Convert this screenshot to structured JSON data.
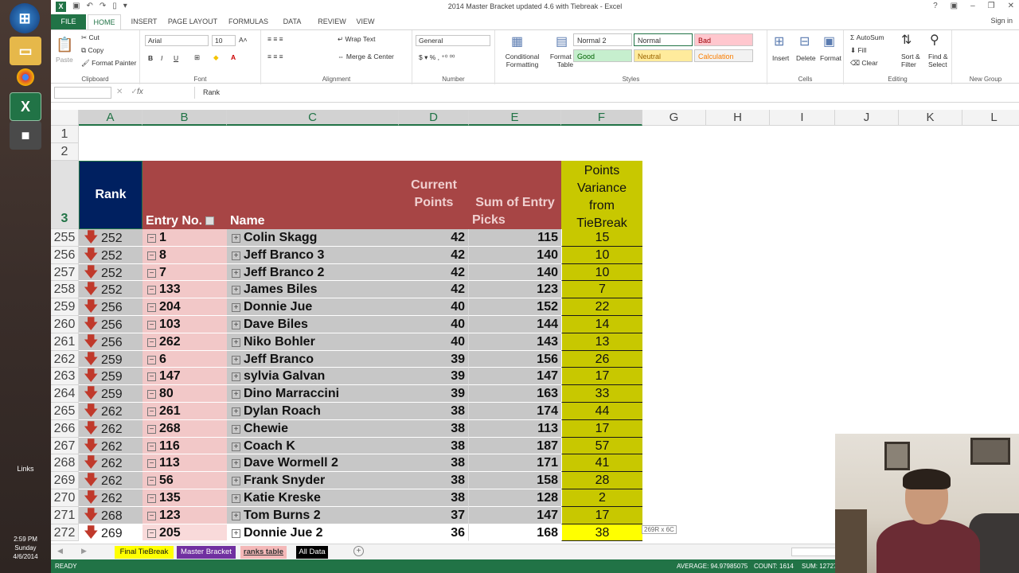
{
  "taskbar": {
    "links_label": "Links",
    "time": "2:59 PM",
    "day": "Sunday",
    "date": "4/6/2014"
  },
  "window": {
    "title": "2014 Master Bracket updated 4.6 with Tiebreak - Excel",
    "signin": "Sign in"
  },
  "ribbon_tabs": [
    "FILE",
    "HOME",
    "INSERT",
    "PAGE LAYOUT",
    "FORMULAS",
    "DATA",
    "REVIEW",
    "VIEW"
  ],
  "ribbon": {
    "clipboard": {
      "cut": "Cut",
      "copy": "Copy",
      "format_painter": "Format Painter",
      "paste": "Paste",
      "label": "Clipboard"
    },
    "font": {
      "name": "Arial",
      "size": "10",
      "label": "Font"
    },
    "alignment": {
      "wrap": "Wrap Text",
      "merge": "Merge & Center",
      "label": "Alignment"
    },
    "number": {
      "format": "General",
      "label": "Number"
    },
    "styles": {
      "conditional": "Conditional Formatting",
      "format_table": "Format as Table",
      "normal2": "Normal 2",
      "normal": "Normal",
      "bad": "Bad",
      "good": "Good",
      "neutral": "Neutral",
      "calculation": "Calculation",
      "label": "Styles"
    },
    "cells": {
      "insert": "Insert",
      "delete": "Delete",
      "format": "Format",
      "label": "Cells"
    },
    "editing": {
      "autosum": "AutoSum",
      "fill": "Fill",
      "clear": "Clear",
      "sort": "Sort & Filter",
      "find": "Find & Select",
      "label": "Editing"
    },
    "new_group": "New Group"
  },
  "formula_bar": {
    "fx": "fx",
    "value": "Rank"
  },
  "columns": [
    "A",
    "B",
    "C",
    "D",
    "E",
    "F",
    "G",
    "H",
    "I",
    "J",
    "K",
    "L"
  ],
  "header_rows": [
    "1",
    "2",
    "3"
  ],
  "table_header": {
    "rank": "Rank",
    "entry_no": "Entry No.",
    "name": "Name",
    "current_points": [
      "Current",
      "Points"
    ],
    "sum_picks": [
      "Sum of Entry",
      "Picks"
    ],
    "variance": [
      "Points",
      "Variance",
      "from",
      "TieBreak"
    ]
  },
  "rows": [
    {
      "row": "255",
      "rank": "252",
      "entry": "1",
      "name": "Colin Skagg",
      "points": "42",
      "sum": "115",
      "variance": "15"
    },
    {
      "row": "256",
      "rank": "252",
      "entry": "8",
      "name": "Jeff Branco 3",
      "points": "42",
      "sum": "140",
      "variance": "10"
    },
    {
      "row": "257",
      "rank": "252",
      "entry": "7",
      "name": "Jeff Branco 2",
      "points": "42",
      "sum": "140",
      "variance": "10"
    },
    {
      "row": "258",
      "rank": "252",
      "entry": "133",
      "name": "James Biles",
      "points": "42",
      "sum": "123",
      "variance": "7"
    },
    {
      "row": "259",
      "rank": "256",
      "entry": "204",
      "name": "Donnie Jue",
      "points": "40",
      "sum": "152",
      "variance": "22"
    },
    {
      "row": "260",
      "rank": "256",
      "entry": "103",
      "name": "Dave Biles",
      "points": "40",
      "sum": "144",
      "variance": "14"
    },
    {
      "row": "261",
      "rank": "256",
      "entry": "262",
      "name": "Niko Bohler",
      "points": "40",
      "sum": "143",
      "variance": "13"
    },
    {
      "row": "262",
      "rank": "259",
      "entry": "6",
      "name": "Jeff Branco",
      "points": "39",
      "sum": "156",
      "variance": "26"
    },
    {
      "row": "263",
      "rank": "259",
      "entry": "147",
      "name": "sylvia Galvan",
      "points": "39",
      "sum": "147",
      "variance": "17"
    },
    {
      "row": "264",
      "rank": "259",
      "entry": "80",
      "name": "Dino Marraccini",
      "points": "39",
      "sum": "163",
      "variance": "33"
    },
    {
      "row": "265",
      "rank": "262",
      "entry": "261",
      "name": "Dylan Roach",
      "points": "38",
      "sum": "174",
      "variance": "44"
    },
    {
      "row": "266",
      "rank": "262",
      "entry": "268",
      "name": "Chewie",
      "points": "38",
      "sum": "113",
      "variance": "17"
    },
    {
      "row": "267",
      "rank": "262",
      "entry": "116",
      "name": "Coach K",
      "points": "38",
      "sum": "187",
      "variance": "57"
    },
    {
      "row": "268",
      "rank": "262",
      "entry": "113",
      "name": "Dave Wormell 2",
      "points": "38",
      "sum": "171",
      "variance": "41"
    },
    {
      "row": "269",
      "rank": "262",
      "entry": "56",
      "name": "Frank Snyder",
      "points": "38",
      "sum": "158",
      "variance": "28"
    },
    {
      "row": "270",
      "rank": "262",
      "entry": "135",
      "name": "Katie Kreske",
      "points": "38",
      "sum": "128",
      "variance": "2"
    },
    {
      "row": "271",
      "rank": "268",
      "entry": "123",
      "name": "Tom Burns 2",
      "points": "37",
      "sum": "147",
      "variance": "17"
    },
    {
      "row": "272",
      "rank": "269",
      "entry": "205",
      "name": "Donnie Jue 2",
      "points": "36",
      "sum": "168",
      "variance": "38"
    }
  ],
  "size_hint": "269R x 6C",
  "sheet_tabs": [
    {
      "label": "Final TieBreak",
      "bg": "#ffff00",
      "fg": "#111111"
    },
    {
      "label": "Master Bracket",
      "bg": "#7030a0",
      "fg": "#ffffff"
    },
    {
      "label": "ranks table",
      "bg": "#f4b8b8",
      "fg": "#333333"
    },
    {
      "label": "All Data",
      "bg": "#000000",
      "fg": "#ffffff"
    }
  ],
  "status": {
    "ready": "READY",
    "average": "AVERAGE: 94.97985075",
    "count": "COUNT: 1614",
    "sum": "SUM: 12727"
  }
}
